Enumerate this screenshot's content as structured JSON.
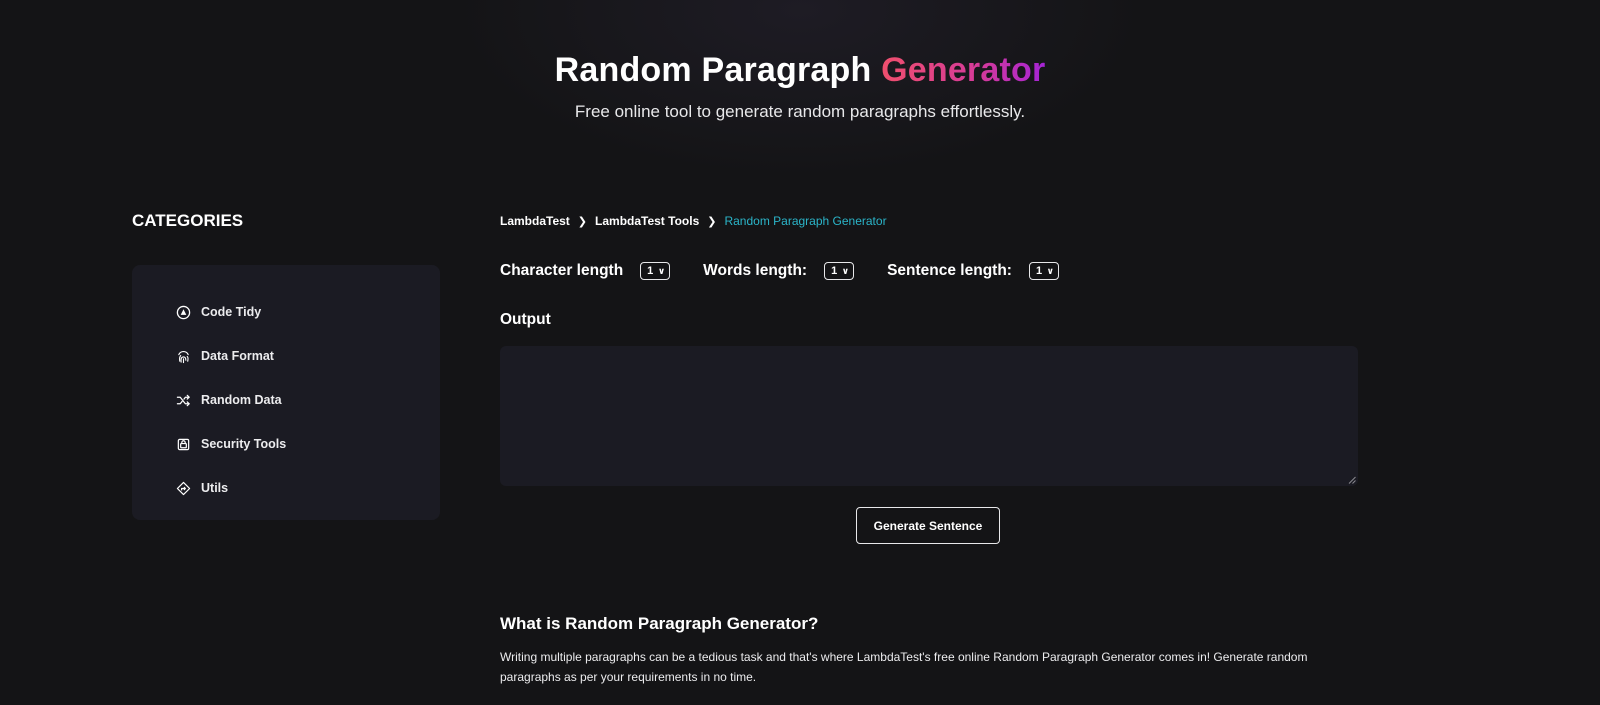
{
  "hero": {
    "title_main": "Random Paragraph",
    "title_accent": "Generator",
    "subtitle": "Free online tool to generate random paragraphs effortlessly."
  },
  "sidebar": {
    "title": "CATEGORIES",
    "items": [
      {
        "label": "Code Tidy",
        "icon": "code-tidy-icon"
      },
      {
        "label": "Data Format",
        "icon": "fingerprint-icon"
      },
      {
        "label": "Random Data",
        "icon": "shuffle-icon"
      },
      {
        "label": "Security Tools",
        "icon": "lock-icon"
      },
      {
        "label": "Utils",
        "icon": "utils-diamond-icon"
      }
    ]
  },
  "breadcrumb": [
    "LambdaTest",
    "LambdaTest Tools",
    "Random Paragraph Generator"
  ],
  "controls": {
    "character_length": {
      "label": "Character length",
      "value": "1"
    },
    "words_length": {
      "label": "Words length:",
      "value": "1"
    },
    "sentence_length": {
      "label": "Sentence length:",
      "value": "1"
    }
  },
  "output": {
    "label": "Output",
    "value": ""
  },
  "generate_button": "Generate Sentence",
  "info": {
    "heading": "What is Random Paragraph Generator?",
    "body": "Writing multiple paragraphs can be a tedious task and that's where LambdaTest's free online Random Paragraph Generator comes in! Generate random paragraphs as per your requirements in no time."
  },
  "colors": {
    "background": "#141416",
    "panel": "#1b1b23",
    "accent_start": "#ef4f6d",
    "accent_end": "#a524d6",
    "breadcrumb_current": "#2bb5c9"
  }
}
